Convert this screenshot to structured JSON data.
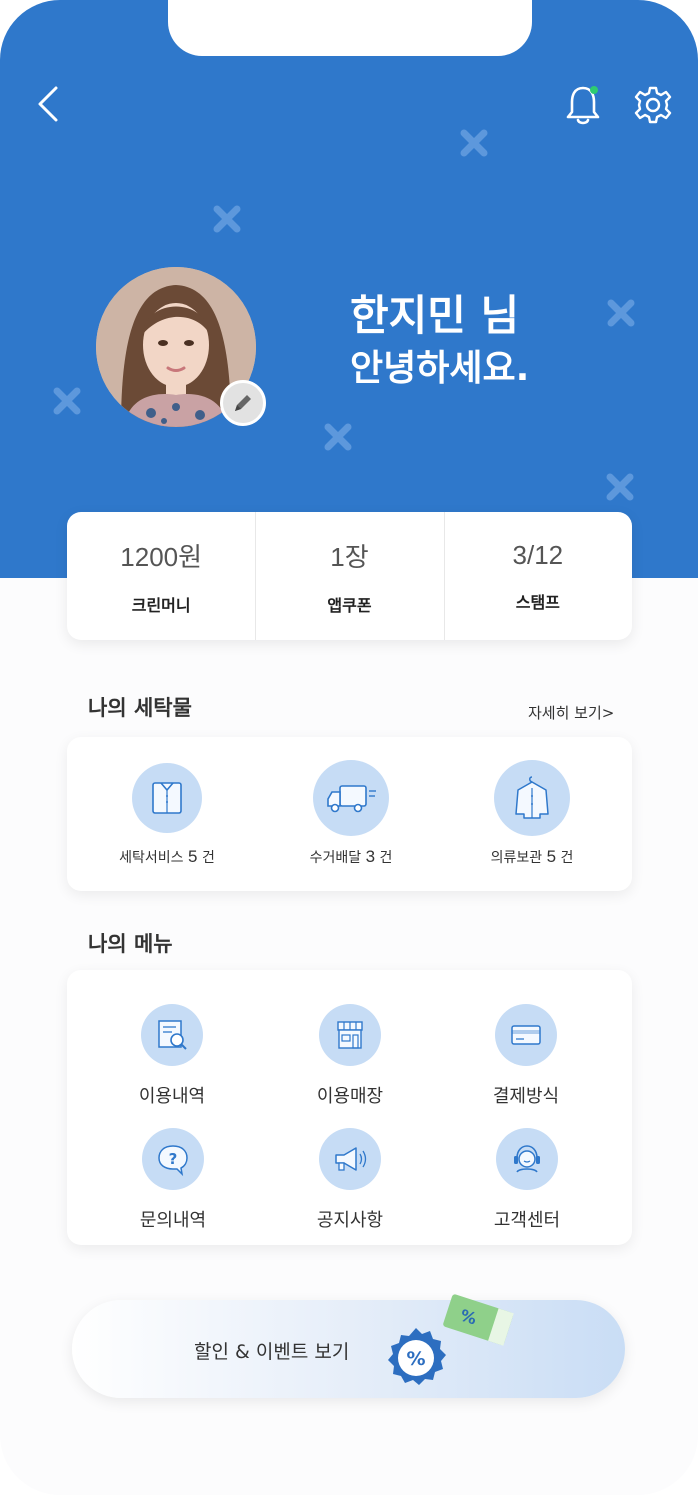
{
  "header": {
    "back_icon": "chevron-left-icon",
    "bell_icon": "bell-icon",
    "settings_icon": "gear-icon",
    "accent_color": "#2f78cb",
    "notification_dot_color": "#2ecc71"
  },
  "profile": {
    "name": "한지민 님",
    "greeting": "안녕하세요.",
    "edit_icon": "pencil-icon"
  },
  "stats": [
    {
      "value": "1200원",
      "label": "크린머니"
    },
    {
      "value": "1장",
      "label": "앱쿠폰"
    },
    {
      "value": "3/12",
      "label": "스탬프"
    }
  ],
  "laundry": {
    "title": "나의 세탁물",
    "more": "자세히 보기>",
    "items": [
      {
        "label": "세탁서비스",
        "count": "5",
        "unit": "건",
        "icon": "shirt-icon"
      },
      {
        "label": "수거배달",
        "count": "3",
        "unit": "건",
        "icon": "delivery-truck-icon"
      },
      {
        "label": "의류보관",
        "count": "5",
        "unit": "건",
        "icon": "hanger-shirt-icon"
      }
    ]
  },
  "menu": {
    "title": "나의 메뉴",
    "items": [
      {
        "label": "이용내역",
        "icon": "document-search-icon"
      },
      {
        "label": "이용매장",
        "icon": "store-icon"
      },
      {
        "label": "결제방식",
        "icon": "credit-card-icon"
      },
      {
        "label": "문의내역",
        "icon": "question-bubble-icon"
      },
      {
        "label": "공지사항",
        "icon": "megaphone-icon"
      },
      {
        "label": "고객센터",
        "icon": "headset-agent-icon"
      }
    ]
  },
  "event": {
    "label": "할인 & 이벤트 보기",
    "badge_text": "%",
    "ticket_text": "%"
  }
}
